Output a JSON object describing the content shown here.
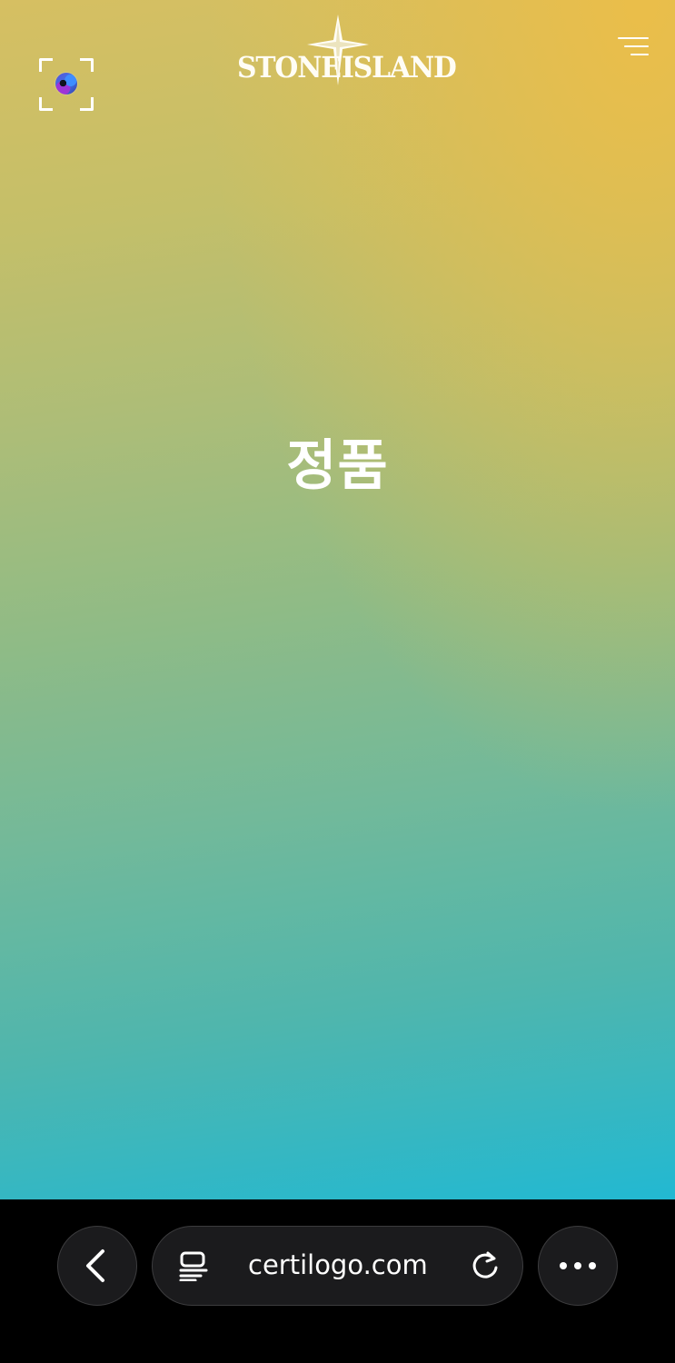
{
  "brand": {
    "logo_left": "STONE",
    "logo_right": "ISLAND",
    "logo_icon": "compass-star-icon"
  },
  "header": {
    "scan_icon": "camera-scan-icon",
    "menu_icon": "menu-icon"
  },
  "main": {
    "status_text": "정품",
    "background_colors": [
      "#e6be4b",
      "#c4bf69",
      "#8fbb86",
      "#4fb6ad",
      "#22b8d2"
    ],
    "text_color": "#ffffff"
  },
  "browser": {
    "back_icon": "chevron-left-icon",
    "page_icon": "page-icon",
    "url": "certilogo.com",
    "reload_icon": "reload-icon",
    "more_icon": "more-horizontal-icon",
    "bar_color": "#000000",
    "control_color": "#1b1b1d"
  }
}
